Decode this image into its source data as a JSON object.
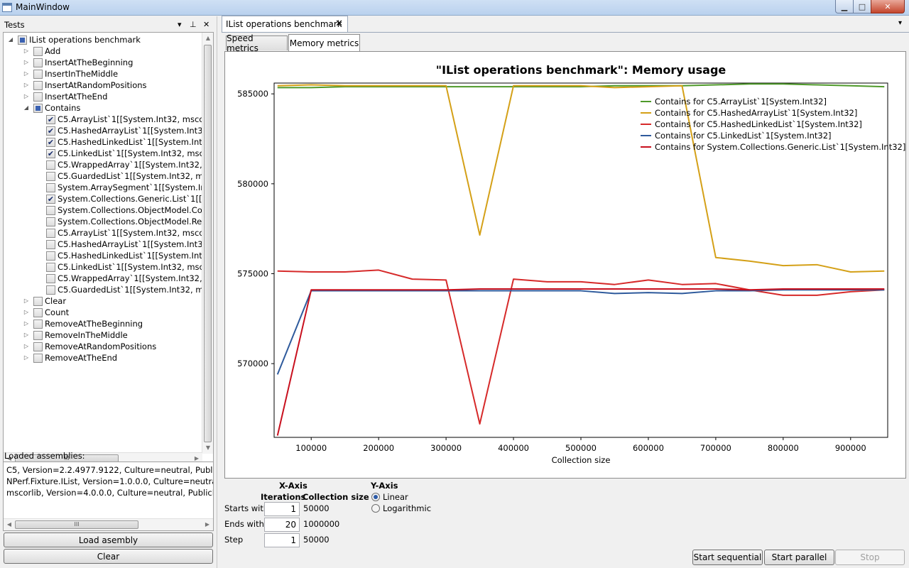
{
  "window": {
    "title": "MainWindow",
    "min_label": "▁",
    "max_label": "□",
    "close_label": "✕"
  },
  "tests_panel": {
    "header": "Tests",
    "dropdown_glyph": "▾",
    "pin_glyph": "⊥",
    "close_glyph": "✕",
    "tree": [
      {
        "level": 0,
        "expander": "◢",
        "checked": "partial",
        "label": "IList operations benchmark"
      },
      {
        "level": 1,
        "expander": "▷",
        "checked": "off",
        "label": "Add"
      },
      {
        "level": 1,
        "expander": "▷",
        "checked": "off",
        "label": "InsertAtTheBeginning"
      },
      {
        "level": 1,
        "expander": "▷",
        "checked": "off",
        "label": "InsertInTheMiddle"
      },
      {
        "level": 1,
        "expander": "▷",
        "checked": "off",
        "label": "InsertAtRandomPositions"
      },
      {
        "level": 1,
        "expander": "▷",
        "checked": "off",
        "label": "InsertAtTheEnd"
      },
      {
        "level": 1,
        "expander": "◢",
        "checked": "partial",
        "label": "Contains"
      },
      {
        "level": 2,
        "expander": "",
        "checked": "on",
        "label": "C5.ArrayList`1[[System.Int32, mscorlib,"
      },
      {
        "level": 2,
        "expander": "",
        "checked": "on",
        "label": "C5.HashedArrayList`1[[System.Int32, m"
      },
      {
        "level": 2,
        "expander": "",
        "checked": "on",
        "label": "C5.HashedLinkedList`1[[System.Int32, m"
      },
      {
        "level": 2,
        "expander": "",
        "checked": "on",
        "label": "C5.LinkedList`1[[System.Int32, mscorlib"
      },
      {
        "level": 2,
        "expander": "",
        "checked": "off",
        "label": "C5.WrappedArray`1[[System.Int32, msc"
      },
      {
        "level": 2,
        "expander": "",
        "checked": "off",
        "label": "C5.GuardedList`1[[System.Int32, mscor"
      },
      {
        "level": 2,
        "expander": "",
        "checked": "off",
        "label": "System.ArraySegment`1[[System.Int32,"
      },
      {
        "level": 2,
        "expander": "",
        "checked": "on",
        "label": "System.Collections.Generic.List`1[[Syst"
      },
      {
        "level": 2,
        "expander": "",
        "checked": "off",
        "label": "System.Collections.ObjectModel.Colle"
      },
      {
        "level": 2,
        "expander": "",
        "checked": "off",
        "label": "System.Collections.ObjectModel.Read"
      },
      {
        "level": 2,
        "expander": "",
        "checked": "off",
        "label": "C5.ArrayList`1[[System.Int32, mscorlib,"
      },
      {
        "level": 2,
        "expander": "",
        "checked": "off",
        "label": "C5.HashedArrayList`1[[System.Int32, m"
      },
      {
        "level": 2,
        "expander": "",
        "checked": "off",
        "label": "C5.HashedLinkedList`1[[System.Int32, m"
      },
      {
        "level": 2,
        "expander": "",
        "checked": "off",
        "label": "C5.LinkedList`1[[System.Int32, mscorlib"
      },
      {
        "level": 2,
        "expander": "",
        "checked": "off",
        "label": "C5.WrappedArray`1[[System.Int32, msc"
      },
      {
        "level": 2,
        "expander": "",
        "checked": "off",
        "label": "C5.GuardedList`1[[System.Int32, mscor"
      },
      {
        "level": 1,
        "expander": "▷",
        "checked": "off",
        "label": "Clear"
      },
      {
        "level": 1,
        "expander": "▷",
        "checked": "off",
        "label": "Count"
      },
      {
        "level": 1,
        "expander": "▷",
        "checked": "off",
        "label": "RemoveAtTheBeginning"
      },
      {
        "level": 1,
        "expander": "▷",
        "checked": "off",
        "label": "RemoveInTheMiddle"
      },
      {
        "level": 1,
        "expander": "▷",
        "checked": "off",
        "label": "RemoveAtRandomPositions"
      },
      {
        "level": 1,
        "expander": "▷",
        "checked": "off",
        "label": "RemoveAtTheEnd"
      }
    ],
    "scroll_thumb_label": "III"
  },
  "assemblies": {
    "label": "Loaded assemblies:",
    "lines": [
      "C5, Version=2.2.4977.9122, Culture=neutral, PublicK",
      "NPerf.Fixture.IList, Version=1.0.0.0, Culture=neutral,",
      "mscorlib, Version=4.0.0.0, Culture=neutral, PublicKe"
    ],
    "load_button": "Load asembly",
    "clear_button": "Clear"
  },
  "document": {
    "tab_title": "IList operations benchmark",
    "tab_close": "✕",
    "dropdown_glyph": "▾",
    "subtabs": [
      "Speed metrics",
      "Memory metrics"
    ],
    "active_subtab": 1
  },
  "chart_data": {
    "type": "line",
    "title": "\"IList operations benchmark\": Memory usage",
    "xlabel": "Collection size",
    "ylabel": "",
    "xlim": [
      45000,
      955000
    ],
    "ylim": [
      565900,
      585600
    ],
    "xticks": [
      100000,
      200000,
      300000,
      400000,
      500000,
      600000,
      700000,
      800000,
      900000
    ],
    "yticks": [
      570000,
      575000,
      580000,
      585000
    ],
    "x": [
      50000,
      100000,
      150000,
      200000,
      250000,
      300000,
      350000,
      400000,
      450000,
      500000,
      550000,
      600000,
      650000,
      700000,
      750000,
      800000,
      850000,
      900000,
      950000
    ],
    "legend_position": "top-right",
    "series": [
      {
        "name": "Contains for C5.ArrayList`1[System.Int32]",
        "color": "#4f9a2a",
        "values": [
          585350,
          585350,
          585400,
          585400,
          585400,
          585400,
          585400,
          585400,
          585400,
          585400,
          585450,
          585450,
          585450,
          585500,
          585550,
          585550,
          585500,
          585450,
          585400
        ]
      },
      {
        "name": "Contains for C5.HashedArrayList`1[System.Int32]",
        "color": "#d4a017",
        "values": [
          585450,
          585500,
          585450,
          585450,
          585450,
          585450,
          577150,
          585450,
          585450,
          585450,
          585350,
          585400,
          585450,
          575900,
          575700,
          575450,
          575500,
          575100,
          575150
        ]
      },
      {
        "name": "Contains for C5.HashedLinkedList`1[System.Int32]",
        "color": "#d62a2a",
        "values": [
          575150,
          575100,
          575100,
          575200,
          574700,
          574650,
          566650,
          574700,
          574550,
          574550,
          574400,
          574650,
          574400,
          574450,
          574100,
          573800,
          573800,
          574000,
          574100
        ]
      },
      {
        "name": "Contains for C5.LinkedList`1[System.Int32]",
        "color": "#2e5a9c",
        "values": [
          569400,
          574050,
          574050,
          574050,
          574050,
          574050,
          574050,
          574050,
          574050,
          574050,
          573900,
          573950,
          573900,
          574050,
          574050,
          574100,
          574100,
          574100,
          574100
        ]
      },
      {
        "name": "Contains for System.Collections.Generic.List`1[System.Int32]",
        "color": "#c8101e",
        "values": [
          566000,
          574100,
          574100,
          574100,
          574100,
          574100,
          574150,
          574150,
          574150,
          574150,
          574150,
          574150,
          574150,
          574150,
          574100,
          574150,
          574150,
          574150,
          574150
        ]
      }
    ]
  },
  "axis_settings": {
    "x_axis_label": "X-Axis",
    "y_axis_label": "Y-Axis",
    "iterations_header": "Iterations",
    "collection_size_header": "Collection size",
    "starts_with_label": "Starts with",
    "ends_with_label": "Ends with",
    "step_label": "Step",
    "starts_with_value": "1",
    "ends_with_value": "20",
    "step_value": "1",
    "starts_collection": "50000",
    "ends_collection": "1000000",
    "step_collection": "50000",
    "linear_label": "Linear",
    "log_label": "Logarithmic",
    "y_scale": "linear"
  },
  "actions": {
    "start_sequential": "Start sequential",
    "start_parallel": "Start parallel",
    "stop": "Stop"
  }
}
